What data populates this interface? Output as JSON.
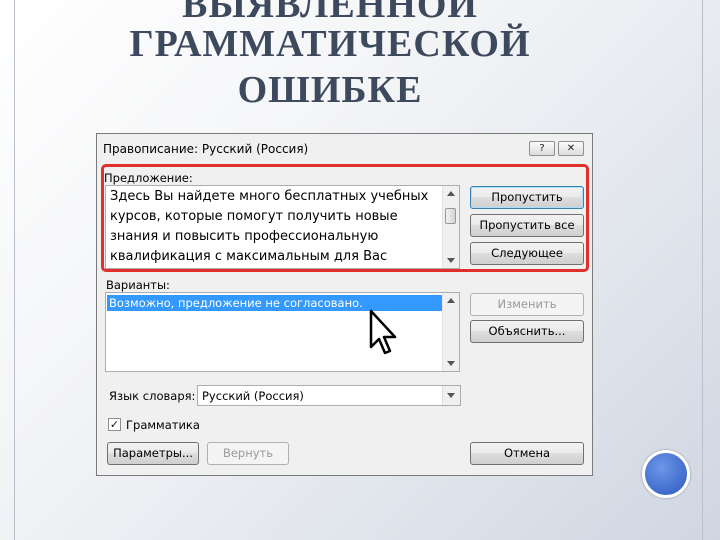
{
  "slide": {
    "title_lines": [
      "ВЫЯВЛЕННОЙ",
      "ГРАММАТИЧЕСКОЙ",
      "ОШИБКЕ"
    ]
  },
  "dialog": {
    "title": "Правописание: Русский (Россия)",
    "help_label": "?",
    "close_label": "✕",
    "sentence_label": "Предложение:",
    "sentence_text": "Здесь Вы найдете много бесплатных учебных\nкурсов, которые помогут получить новые\nзнания и повысить профессиональную\nквалификация с максимальным для Вас",
    "buttons": {
      "ignore": "Пропустить",
      "ignore_all": "Пропустить все",
      "next": "Следующее",
      "change": "Изменить",
      "explain": "Объяснить...",
      "options": "Параметры...",
      "undo": "Вернуть",
      "cancel": "Отмена"
    },
    "variants_label": "Варианты:",
    "variants": [
      "Возможно, предложение не согласовано."
    ],
    "dictionary_label": "Язык словаря:",
    "dictionary_value": "Русский (Россия)",
    "grammar_label": "Грамматика",
    "grammar_checked": true
  },
  "colors": {
    "highlight_border": "#e0302a",
    "selection": "#3399ff",
    "title_text": "#3d4a5e",
    "bullet_circle": "#4a76d4"
  }
}
